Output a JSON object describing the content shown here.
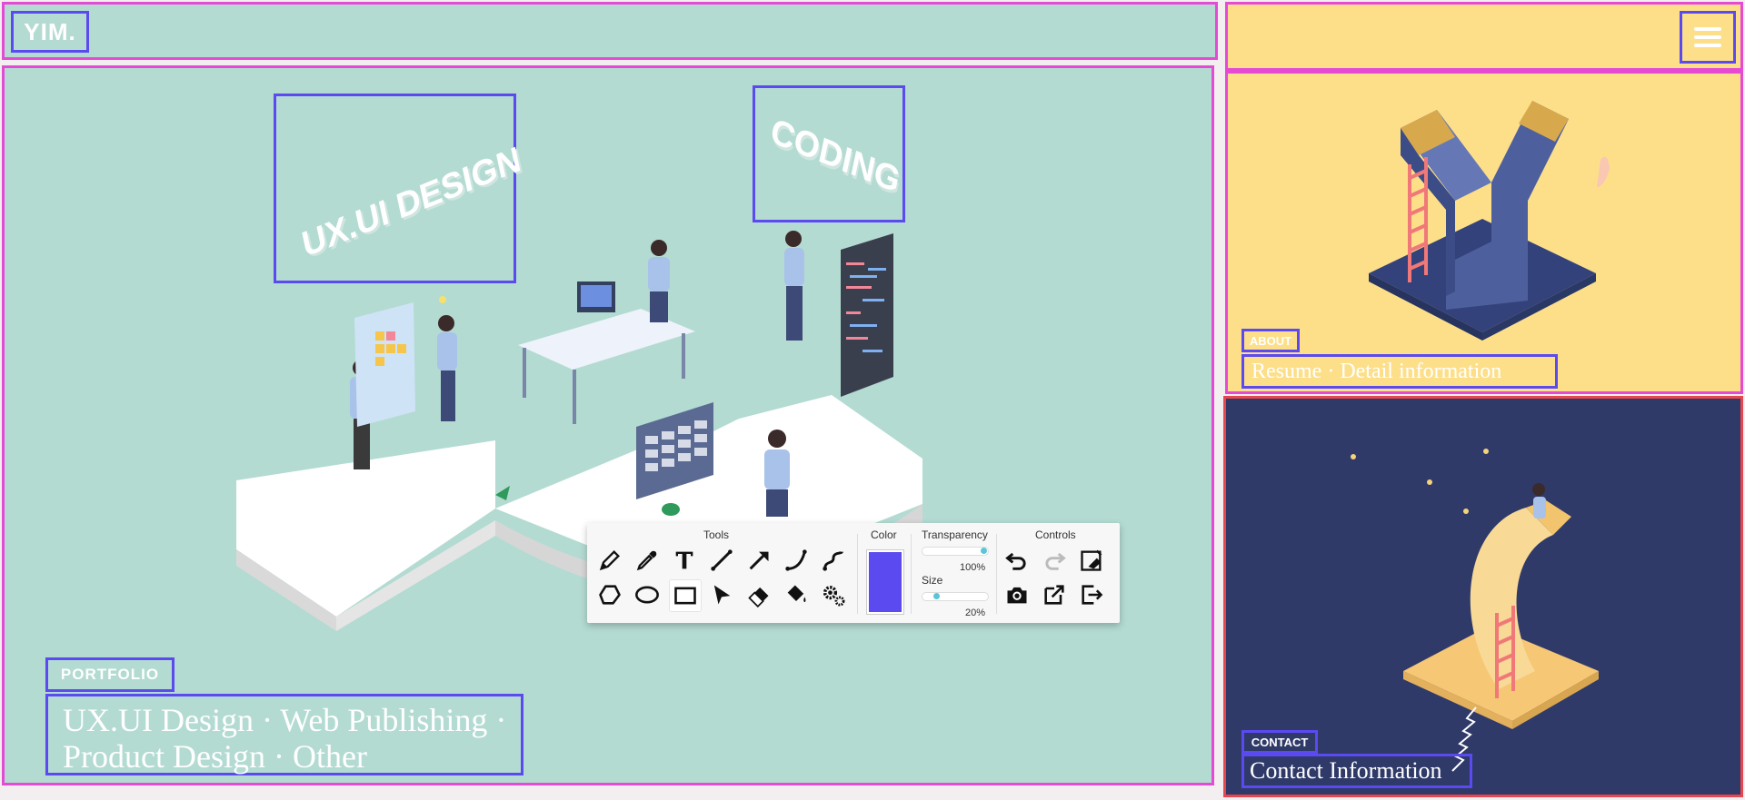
{
  "header": {
    "logo_text": "YIM."
  },
  "portfolio": {
    "badge": "PORTFOLIO",
    "description": "UX.UI Design · Web Publishing · Product Design · Other",
    "illustration_labels": {
      "uxui": "UX.UI DESIGN",
      "coding": "CODING"
    }
  },
  "about": {
    "badge": "ABOUT",
    "description": "Resume · Detail information"
  },
  "contact": {
    "badge": "CONTACT",
    "description": "Contact Information"
  },
  "toolbar": {
    "tools_title": "Tools",
    "color_title": "Color",
    "transparency_title": "Transparency",
    "transparency_value": "100%",
    "transparency_level": 1.0,
    "size_title": "Size",
    "size_value": "20%",
    "size_level": 0.2,
    "controls_title": "Controls",
    "selected_color": "#5b4af0",
    "tools": [
      "pencil-icon",
      "eyedropper-icon",
      "text-icon",
      "line-icon",
      "arrow-icon",
      "curve-icon",
      "freehand-curve-icon",
      "lasso-icon",
      "ellipse-icon",
      "rectangle-icon",
      "select-icon",
      "eraser-icon",
      "fill-bucket-icon",
      "settings-icon"
    ],
    "controls": [
      "undo-icon",
      "redo-icon",
      "clear-icon",
      "camera-icon",
      "export-icon",
      "exit-icon"
    ]
  },
  "colors": {
    "mint": "#b3dbd2",
    "yellow": "#fddf8a",
    "navy": "#2f3a69",
    "outline_pink": "#e44ad3",
    "outline_blue": "#5b4af0",
    "outline_red": "#e8464e"
  }
}
